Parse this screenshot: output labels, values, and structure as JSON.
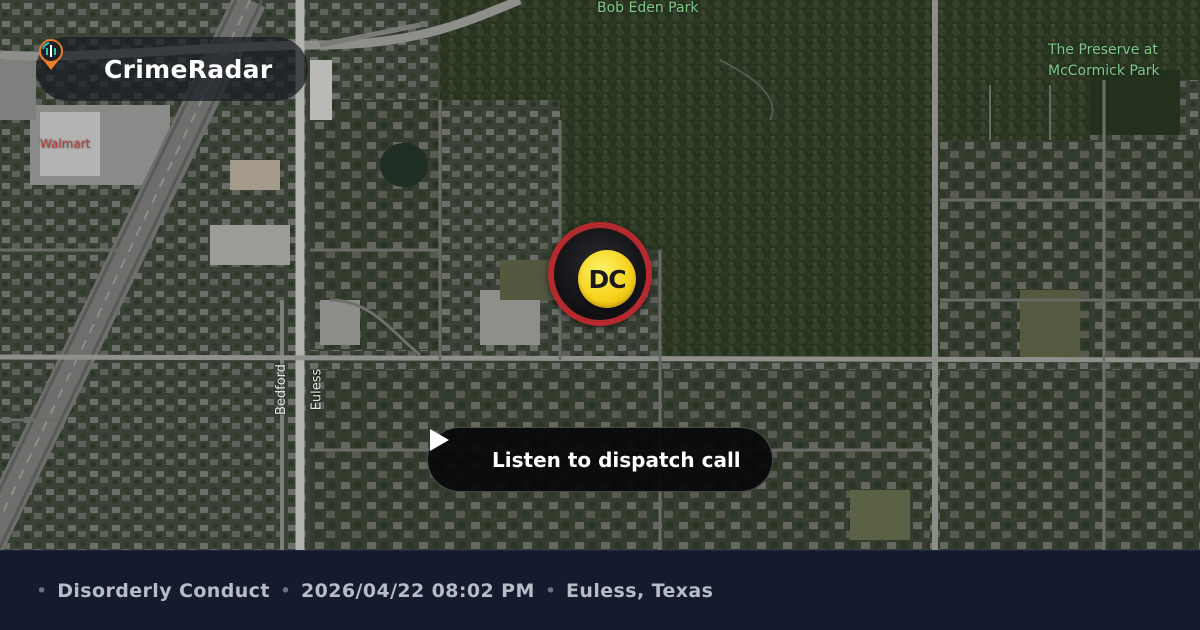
{
  "brand": {
    "name": "CrimeRadar",
    "logo_icon": "radar-pin-icon",
    "logo_colors": [
      "#2ec4b6",
      "#f07c2a",
      "#ffffff"
    ]
  },
  "map": {
    "style": "satellite",
    "poi_labels": {
      "bob_eden_park": "Bob Eden Park",
      "preserve_line1": "The Preserve at",
      "preserve_line2": "McCormick Park",
      "walmart": "Walmart"
    },
    "road_labels": {
      "bedford": "Bedford",
      "euless": "Euless"
    }
  },
  "marker": {
    "code": "DC",
    "ring_color": "#b42a2f",
    "badge_color": "#f6d31c"
  },
  "listen_button": {
    "label": "Listen to dispatch call",
    "icon": "play-icon"
  },
  "footer": {
    "incident_type": "Disorderly Conduct",
    "datetime": "2026/04/22 08:02 PM",
    "location": "Euless, Texas",
    "separator": "•"
  }
}
